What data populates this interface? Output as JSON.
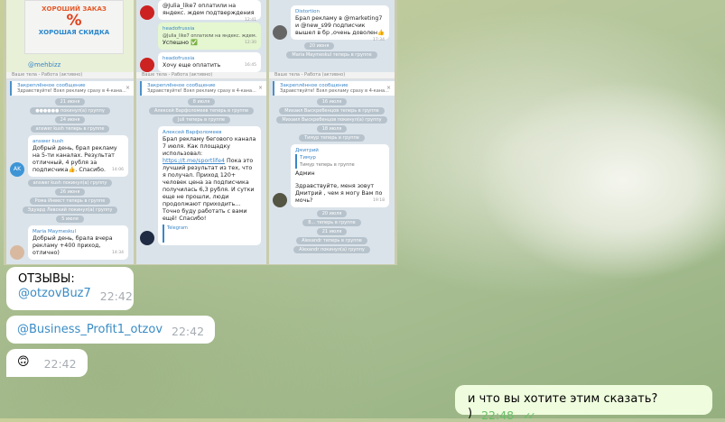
{
  "collage": {
    "promo": {
      "line1": "ХОРОШИЙ ЗАКАЗ",
      "symbol": "%",
      "line2": "ХОРОШАЯ СКИДКА",
      "handle": "@mehbizz"
    },
    "chat_top2": {
      "msg1": "@Julia_like7 оплатили на яндекс. ждем подтверждения",
      "time1": "12:41",
      "reply_name": "headofrussia",
      "reply_text": "@Julia_like7 оплатили на яндекс. ждем...",
      "msg2": "Успешно ✅",
      "time2": "12:30",
      "name3": "headofrussia",
      "msg3": "Хочу еще оплатить",
      "time3": "16:45"
    },
    "chat_top3": {
      "name": "Distortion",
      "msg": "Брал рекламу в @marketing7 и @new_s99 подписчик вышел в бр ,очень доволен👍",
      "time": "17:34",
      "date": "20 июня",
      "svc": "Maria Maymeskul теперь в группе"
    },
    "header": "Ваше тела - Работа (активно)",
    "pinned_title": "Закреплённое сообщение",
    "pinned_text": "Здравствуйте! Взял рекламу сразу в 4-кана...",
    "chat1": {
      "svc": [
        "21 июня",
        "●●●●●● покинул(а) группу",
        "24 июня",
        "answer kush теперь в группе"
      ],
      "name": "answer kush",
      "msg": "Добрый день, брал рекламу на 5-ти каналах. Результат отличный, 4 рубля за подписчика👍. Спасибо.",
      "time": "14:06",
      "avatar": "AK",
      "svc2": [
        "answer kush покинул(а) группу",
        "26 июня",
        "Рома Инвест теперь в группе",
        "Эдуард Левский покинул(а) группу",
        "5 июля"
      ],
      "name2": "Maria Maymeskul",
      "msg2": "Добрый день, брала вчера рекламу +400 приход, отлично)",
      "time2": "14:34"
    },
    "chat2": {
      "svc": [
        "8 июля",
        "Алексей Варфоломеев теперь в группе",
        "Juli теперь в группе"
      ],
      "name": "Алексей Варфоломеев",
      "msg_a": "Брал рекламу бегового канала 7 июля. Как площадку использовал:",
      "link": "https://t.me/sportlife4",
      "msg_b": "Пока это лучший результат из тех, что я получал. Приход 120+ человек цена за подписчика получилась 6,3 рубля. И сутки еще не прошли, люди продолжают приходить... Точно буду работать с вами ещё! Спасибо!",
      "preview": "Telegram"
    },
    "chat3": {
      "svc": [
        "16 июля",
        "Михаил Выскребенцов теперь в группе",
        "Михаил Выскребенцов покинул(а) группу",
        "18 июля",
        "Тимур теперь в группе"
      ],
      "name": "Дмитрий",
      "reply_name": "Тимур",
      "reply_text": "Тимур теперь в группе",
      "msg_a": "Админ",
      "msg_b": "Здравствуйте, меня зовут Дмитрий , чем я могу Вам по мочь?",
      "time": "19:18",
      "svc2": [
        "20 июля",
        "8... теперь в группе",
        "21 июля",
        "Alexandr теперь в группе",
        "Alexandr покинул(а) группу"
      ]
    }
  },
  "messages": [
    {
      "text": "ОТЗЫВЫ:",
      "link": "@otzovBuz7",
      "time": "22:42"
    },
    {
      "link": "@Business_Profit1_otzov",
      "time": "22:42"
    },
    {
      "emoji": "🙃",
      "time": "22:42"
    }
  ],
  "outgoing": {
    "text": "и что вы хотите этим сказать? )",
    "time": "22:48",
    "status": "✓✓"
  }
}
